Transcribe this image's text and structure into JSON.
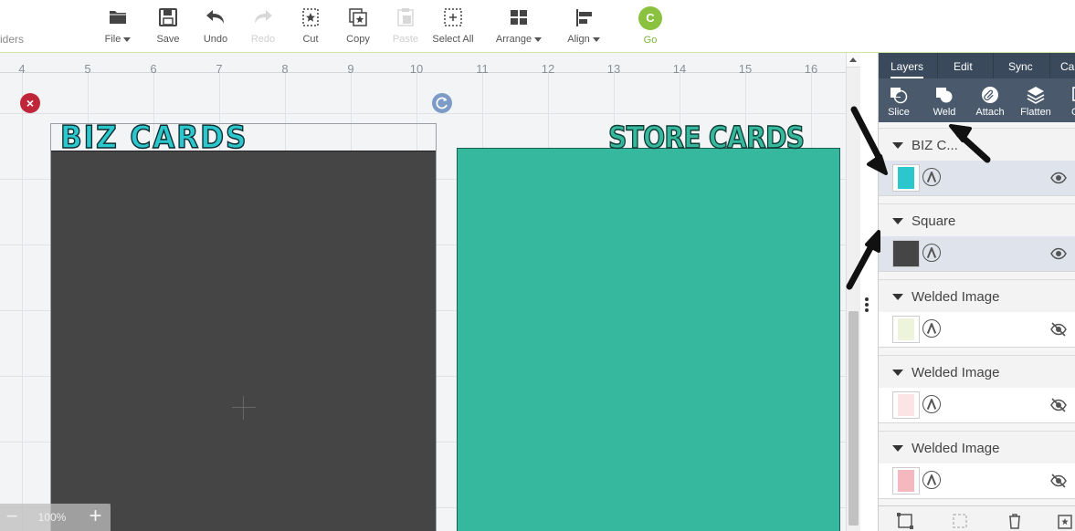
{
  "toolbar": {
    "left_fragment": "iders",
    "file": "File",
    "save": "Save",
    "undo": "Undo",
    "redo": "Redo",
    "cut": "Cut",
    "copy": "Copy",
    "paste": "Paste",
    "select_all": "Select All",
    "arrange": "Arrange",
    "align": "Align",
    "go": "Go",
    "go_glyph": "C"
  },
  "ruler": {
    "ticks": [
      "4",
      "5",
      "6",
      "7",
      "8",
      "9",
      "10",
      "11",
      "12",
      "13",
      "14",
      "15",
      "16"
    ]
  },
  "canvas": {
    "biz_title": "BIZ CARDS",
    "store_title": "STORE CARDS",
    "close_glyph": "×",
    "dark_card_color": "#454545",
    "teal_card_color": "#35b89e"
  },
  "zoom": {
    "value": "100%",
    "minus": "−",
    "plus": "+"
  },
  "panel": {
    "tabs": [
      "Layers",
      "Edit",
      "Sync",
      "Ca"
    ],
    "actions": [
      "Slice",
      "Weld",
      "Attach",
      "Flatten",
      "Co"
    ],
    "groups": [
      {
        "name": "BIZ C...",
        "thumb_color": "#2cc7cc",
        "visible": true,
        "selected": true
      },
      {
        "name": "Square",
        "thumb_color": "#454545",
        "visible": true,
        "selected": true
      },
      {
        "name": "Welded Image",
        "thumb_color": "#eef3dc",
        "visible": false,
        "selected": false
      },
      {
        "name": "Welded Image",
        "thumb_color": "#fde4e4",
        "visible": false,
        "selected": false
      },
      {
        "name": "Welded Image",
        "thumb_color": "#f5b8bf",
        "visible": false,
        "selected": false
      }
    ]
  },
  "colors": {
    "accent_green": "#8ac13f",
    "panel_dark": "#3a4a5c",
    "delete_red": "#c0263a"
  }
}
